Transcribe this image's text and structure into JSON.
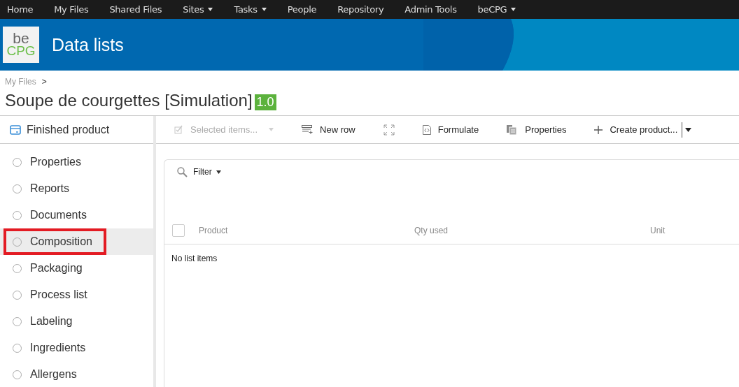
{
  "top_nav": [
    {
      "label": "Home",
      "has_menu": false
    },
    {
      "label": "My Files",
      "has_menu": false
    },
    {
      "label": "Shared Files",
      "has_menu": false
    },
    {
      "label": "Sites",
      "has_menu": true
    },
    {
      "label": "Tasks",
      "has_menu": true
    },
    {
      "label": "People",
      "has_menu": false
    },
    {
      "label": "Repository",
      "has_menu": false
    },
    {
      "label": "Admin Tools",
      "has_menu": false
    },
    {
      "label": "beCPG",
      "has_menu": true
    }
  ],
  "banner": {
    "logo_top": "be",
    "logo_bottom": "CPG",
    "title": "Data lists"
  },
  "breadcrumb": {
    "items": [
      "My Files"
    ],
    "separator": ">"
  },
  "page_title": "Soupe de courgettes [Simulation]",
  "version": "1.0",
  "sidebar": {
    "header": "Finished product",
    "items": [
      {
        "label": "Properties",
        "selected": false,
        "highlighted": false
      },
      {
        "label": "Reports",
        "selected": false,
        "highlighted": false
      },
      {
        "label": "Documents",
        "selected": false,
        "highlighted": false
      },
      {
        "label": "Composition",
        "selected": true,
        "highlighted": true
      },
      {
        "label": "Packaging",
        "selected": false,
        "highlighted": false
      },
      {
        "label": "Process list",
        "selected": false,
        "highlighted": false
      },
      {
        "label": "Labeling",
        "selected": false,
        "highlighted": false
      },
      {
        "label": "Ingredients",
        "selected": false,
        "highlighted": false
      },
      {
        "label": "Allergens",
        "selected": false,
        "highlighted": false
      }
    ]
  },
  "toolbar": [
    {
      "kind": "selected",
      "label": "Selected items...",
      "disabled": true,
      "has_menu": true
    },
    {
      "kind": "new-row",
      "label": "New row",
      "disabled": false,
      "has_menu": false
    },
    {
      "kind": "fullscreen",
      "disabled": false,
      "has_menu": false
    },
    {
      "kind": "formulate",
      "label": "Formulate",
      "disabled": false,
      "has_menu": false
    },
    {
      "kind": "properties",
      "label": "Properties",
      "disabled": false,
      "has_menu": false
    },
    {
      "kind": "create",
      "label": "Create product...",
      "disabled": false,
      "has_menu": true
    }
  ],
  "filter": {
    "label": "Filter"
  },
  "table": {
    "select_all_checked": false,
    "columns": [
      "Product",
      "Qty used",
      "Unit"
    ],
    "empty_message": "No list items"
  }
}
